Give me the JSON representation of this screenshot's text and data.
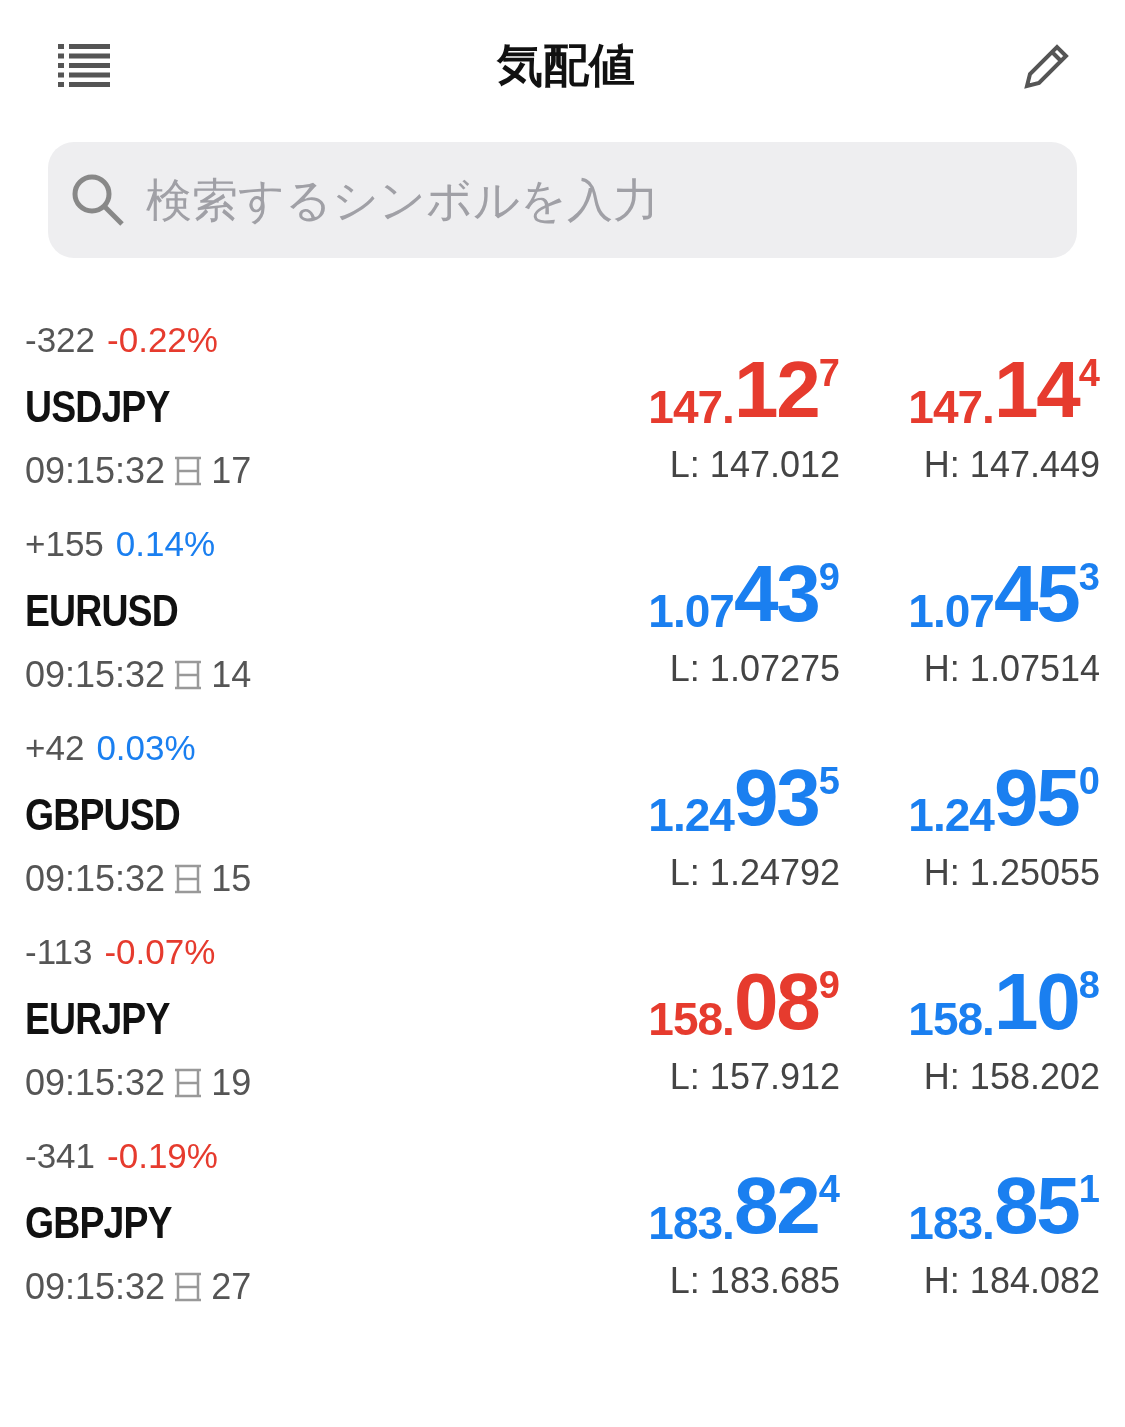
{
  "header": {
    "title": "気配値"
  },
  "search": {
    "placeholder": "検索するシンボルを入力"
  },
  "quotes": [
    {
      "change": "-322",
      "percent": "-0.22%",
      "color": "#e63b2e",
      "symbol": "USDJPY",
      "time": "09:15:32",
      "spread": "17",
      "bid": {
        "head": "147.",
        "big": "12",
        "tail": "7",
        "color": "#e63b2e"
      },
      "ask": {
        "head": "147.",
        "big": "14",
        "tail": "4",
        "color": "#e63b2e"
      },
      "low": "L: 147.012",
      "high": "H: 147.449"
    },
    {
      "change": "+155",
      "percent": "0.14%",
      "color": "#1a7ff0",
      "symbol": "EURUSD",
      "time": "09:15:32",
      "spread": "14",
      "bid": {
        "head": "1.07",
        "big": "43",
        "tail": "9",
        "color": "#1a7ff0"
      },
      "ask": {
        "head": "1.07",
        "big": "45",
        "tail": "3",
        "color": "#1a7ff0"
      },
      "low": "L: 1.07275",
      "high": "H: 1.07514"
    },
    {
      "change": "+42",
      "percent": "0.03%",
      "color": "#1a7ff0",
      "symbol": "GBPUSD",
      "time": "09:15:32",
      "spread": "15",
      "bid": {
        "head": "1.24",
        "big": "93",
        "tail": "5",
        "color": "#1a7ff0"
      },
      "ask": {
        "head": "1.24",
        "big": "95",
        "tail": "0",
        "color": "#1a7ff0"
      },
      "low": "L: 1.24792",
      "high": "H: 1.25055"
    },
    {
      "change": "-113",
      "percent": "-0.07%",
      "color": "#e63b2e",
      "symbol": "EURJPY",
      "time": "09:15:32",
      "spread": "19",
      "bid": {
        "head": "158.",
        "big": "08",
        "tail": "9",
        "color": "#e63b2e"
      },
      "ask": {
        "head": "158.",
        "big": "10",
        "tail": "8",
        "color": "#1a7ff0"
      },
      "low": "L: 157.912",
      "high": "H: 158.202"
    },
    {
      "change": "-341",
      "percent": "-0.19%",
      "color": "#e63b2e",
      "symbol": "GBPJPY",
      "time": "09:15:32",
      "spread": "27",
      "bid": {
        "head": "183.",
        "big": "82",
        "tail": "4",
        "color": "#1a7ff0"
      },
      "ask": {
        "head": "183.",
        "big": "85",
        "tail": "1",
        "color": "#1a7ff0"
      },
      "low": "L: 183.685",
      "high": "H: 184.082"
    }
  ]
}
